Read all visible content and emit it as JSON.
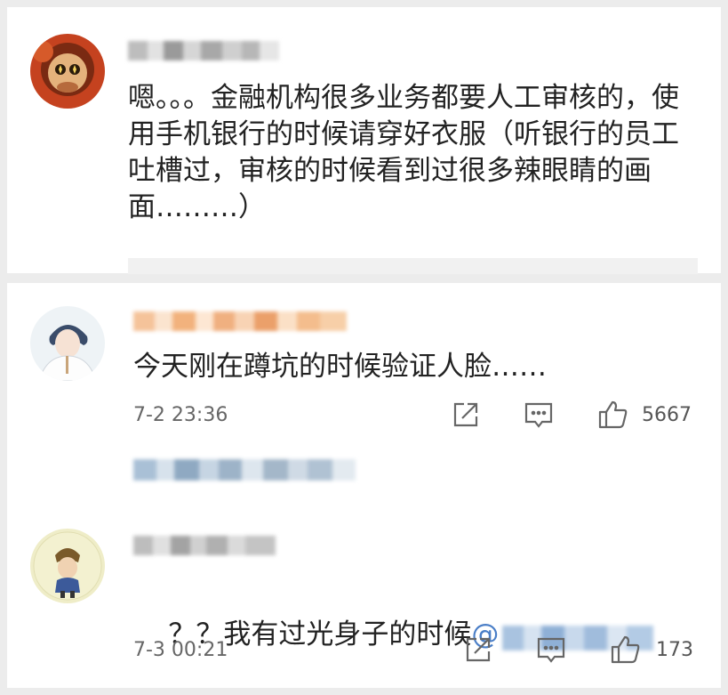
{
  "comments": [
    {
      "text": "嗯。。。金融机构很多业务都要人工审核的，使用手机银行的时候请穿好衣服（听银行的员工吐槽过，审核的时候看到过很多辣眼睛的画面………）"
    },
    {
      "text": "今天刚在蹲坑的时候验证人脸……",
      "time": "7-2 23:36",
      "likes": "5667"
    },
    {
      "text_prefix": "？？我有过光身子的时候",
      "mention": "@",
      "time": "7-3 00:21",
      "likes": "173"
    }
  ],
  "icons": {
    "share": "share-icon",
    "comment": "comment-icon",
    "like": "thumbs-up-icon"
  },
  "colors": {
    "background": "#ececec",
    "card": "#ffffff",
    "link": "#4a7ec7",
    "meta_text": "#666666"
  }
}
